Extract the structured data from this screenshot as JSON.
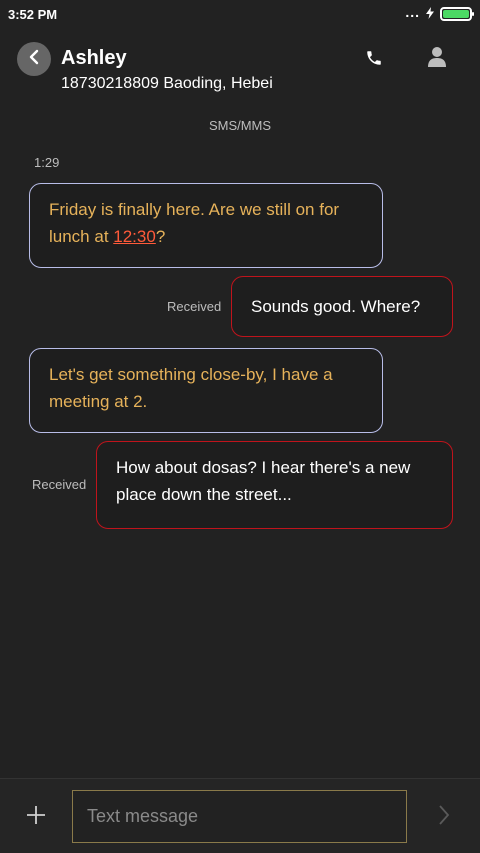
{
  "status_bar": {
    "time": "3:52 PM",
    "signal_dots": "...",
    "charging_icon": "bolt-icon",
    "battery_level": 1.0,
    "battery_color": "#4cd964"
  },
  "header": {
    "back_icon": "chevron-left-icon",
    "contact_name": "Ashley",
    "contact_sub": "18730218809 Baoding, Hebei",
    "call_icon": "phone-icon",
    "profile_icon": "person-icon"
  },
  "conversation": {
    "channel": "SMS/MMS",
    "timestamp": "1:29",
    "messages": [
      {
        "direction": "in",
        "text_before": "Friday is finally here. Are we still on for lunch at ",
        "link": "12:30",
        "text_after": "?"
      },
      {
        "direction": "out",
        "status": "Received",
        "text": "Sounds good. Where?"
      },
      {
        "direction": "in",
        "text": "Let's get something close-by, I have a meeting at 2."
      },
      {
        "direction": "out",
        "status": "Received",
        "text": "How about dosas? I hear there's a new place down the street..."
      }
    ]
  },
  "composer": {
    "add_icon": "plus-icon",
    "placeholder": "Text message",
    "value": "",
    "send_icon": "chevron-right-icon"
  },
  "colors": {
    "background": "#222222",
    "incoming_border": "#b8bde8",
    "incoming_text": "#e6b25a",
    "outgoing_border": "#c0141c",
    "link": "#ff5a3a",
    "input_border": "#8a7a4a"
  }
}
